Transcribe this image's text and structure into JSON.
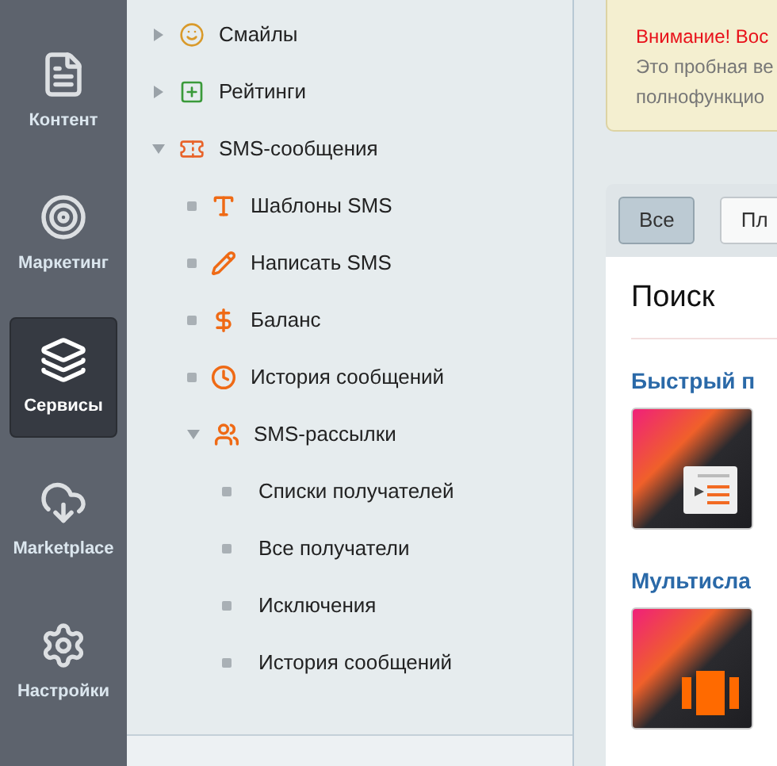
{
  "rail": [
    {
      "label": "Контент",
      "selected": false
    },
    {
      "label": "Маркетинг",
      "selected": false
    },
    {
      "label": "Сервисы",
      "selected": true
    },
    {
      "label": "Marketplace",
      "selected": false
    },
    {
      "label": "Настройки",
      "selected": false
    }
  ],
  "tree": [
    {
      "label": "Смайлы",
      "expanded": false
    },
    {
      "label": "Рейтинги",
      "expanded": false
    },
    {
      "label": "SMS-сообщения",
      "expanded": true,
      "children": [
        {
          "label": "Шаблоны SMS"
        },
        {
          "label": "Написать SMS"
        },
        {
          "label": "Баланс"
        },
        {
          "label": "История сообщений"
        },
        {
          "label": "SMS-рассылки",
          "expanded": true,
          "children": [
            {
              "label": "Списки получателей"
            },
            {
              "label": "Все получатели"
            },
            {
              "label": "Исключения"
            },
            {
              "label": "История сообщений"
            }
          ]
        }
      ]
    }
  ],
  "notice": {
    "title": "Внимание! Вос",
    "lines": [
      "Это пробная ве",
      "полнофункцио"
    ]
  },
  "filters": [
    {
      "label": "Все",
      "selected": true
    },
    {
      "label": "Пл",
      "selected": false
    }
  ],
  "search": {
    "title": "Поиск",
    "apps": [
      {
        "name": "Быстрый п",
        "kind": "list"
      },
      {
        "name": "Мультисла",
        "kind": "slider"
      }
    ]
  }
}
